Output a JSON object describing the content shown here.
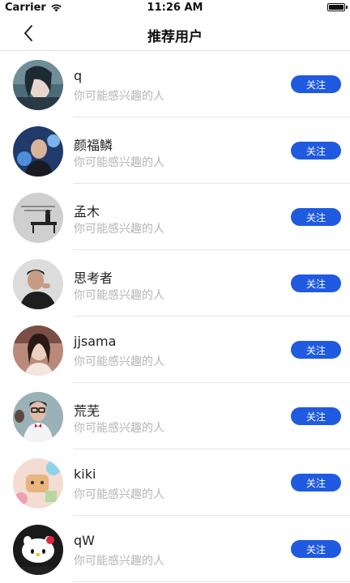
{
  "status_bar": {
    "carrier": "Carrier",
    "time": "11:26 AM"
  },
  "nav": {
    "title": "推荐用户"
  },
  "users": [
    {
      "name": "q",
      "subtitle": "你可能感兴趣的人",
      "button": "关注"
    },
    {
      "name": "颜福鳞",
      "subtitle": "你可能感兴趣的人",
      "button": "关注"
    },
    {
      "name": "孟木",
      "subtitle": "你可能感兴趣的人",
      "button": "关注"
    },
    {
      "name": "思考者",
      "subtitle": "你可能感兴趣的人",
      "button": "关注"
    },
    {
      "name": "jjsama",
      "subtitle": "你可能感兴趣的人",
      "button": "关注"
    },
    {
      "name": "荒芜",
      "subtitle": "你可能感兴趣的人",
      "button": "关注"
    },
    {
      "name": "kiki",
      "subtitle": "你可能感兴趣的人",
      "button": "关注"
    },
    {
      "name": "qW",
      "subtitle": "你可能感兴趣的人",
      "button": "关注"
    }
  ],
  "colors": {
    "accent": "#1f5ae0",
    "subtitle": "#b5b5b5",
    "divider": "#e6e6e6"
  }
}
